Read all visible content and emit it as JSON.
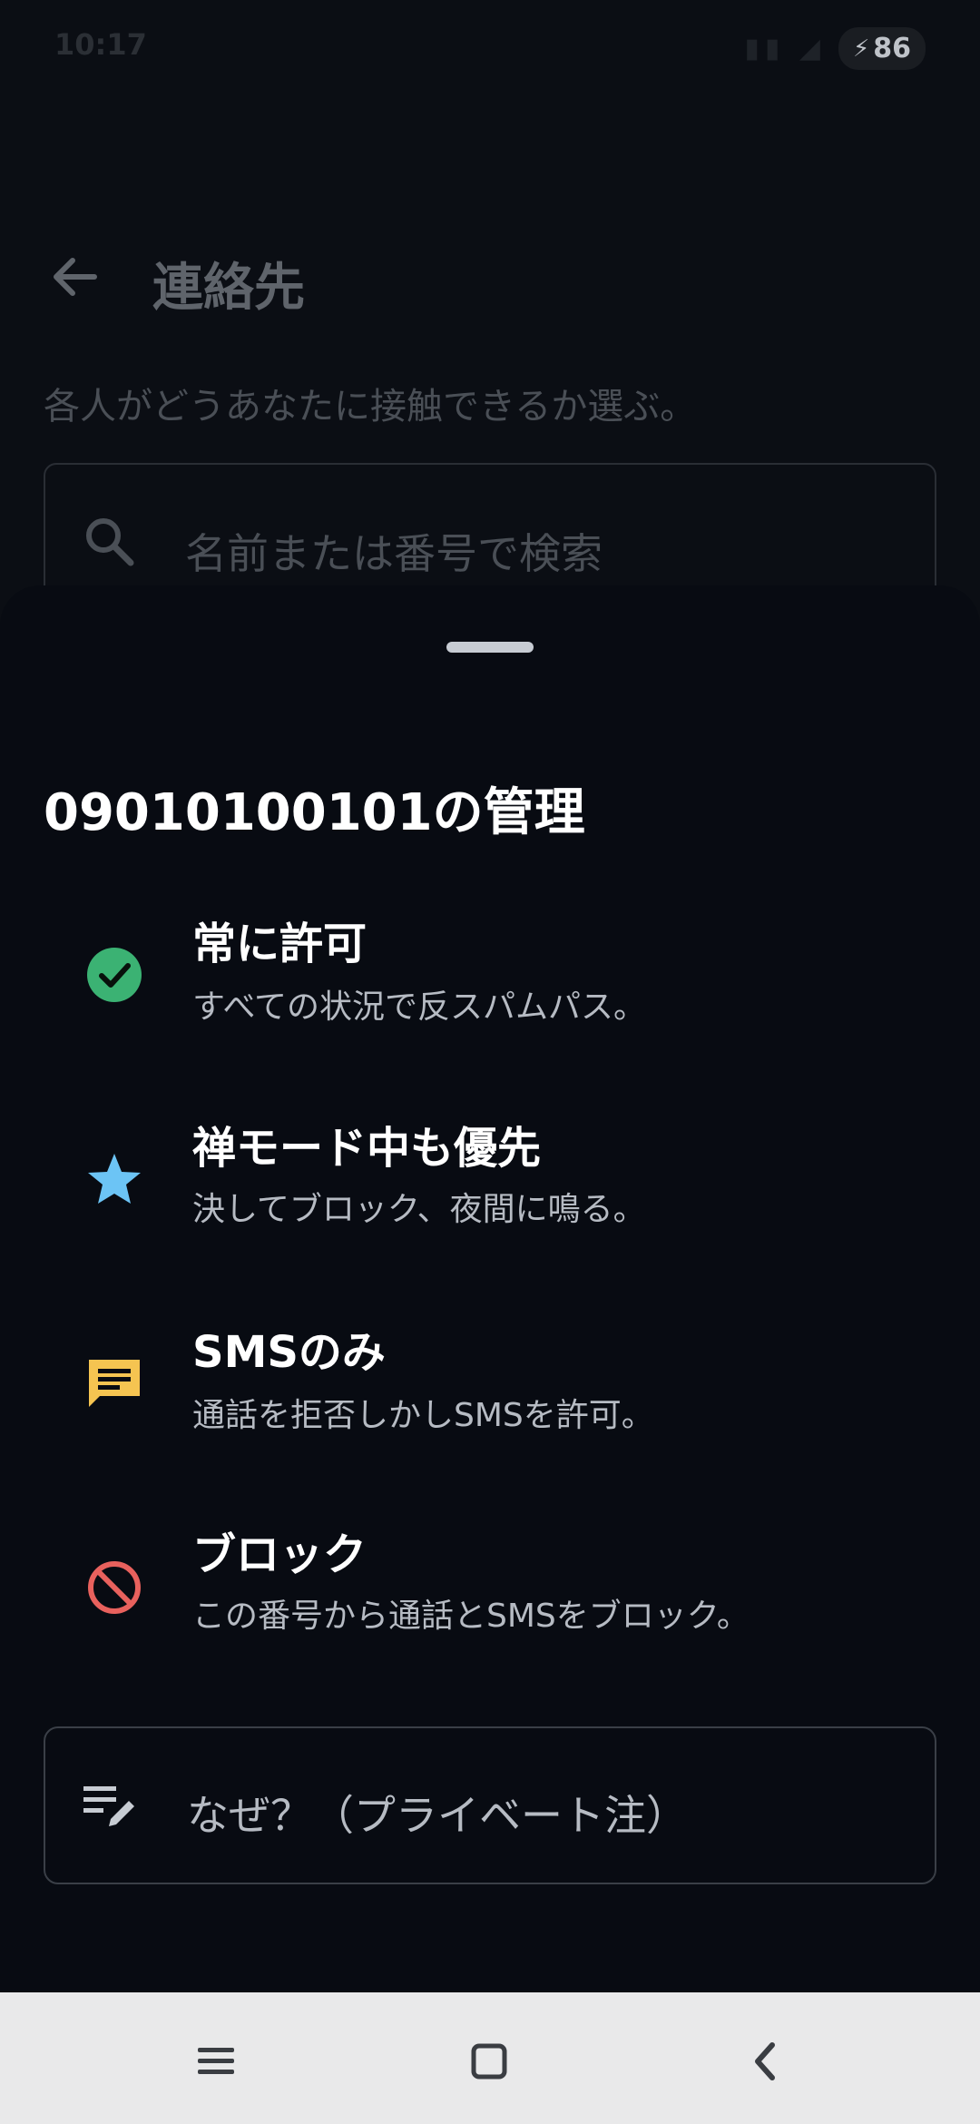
{
  "status_bar": {
    "time": "10:17",
    "battery_level": "86"
  },
  "app_bar": {
    "title": "連絡先"
  },
  "page": {
    "subtitle": "各人がどうあなたに接触できるか選ぶ。",
    "search": {
      "placeholder": "名前または番号で検索"
    }
  },
  "sheet": {
    "title": "09010100101の管理",
    "options": [
      {
        "title": "常に許可",
        "description": "すべての状況で反スパムパス。",
        "icon": "check-circle-icon",
        "color": "#3bb273"
      },
      {
        "title": "禅モード中も優先",
        "description": "決してブロック、夜間に鳴る。",
        "icon": "star-icon",
        "color": "#6cc4f5"
      },
      {
        "title": "SMSのみ",
        "description": "通話を拒否しかしSMSを許可。",
        "icon": "message-icon",
        "color": "#f5c451"
      },
      {
        "title": "ブロック",
        "description": "この番号から通話とSMSをブロック。",
        "icon": "block-icon",
        "color": "#e8615d"
      }
    ],
    "note": {
      "label": "なぜ？（プライベート注）",
      "icon": "edit-note-icon"
    }
  },
  "nav": {
    "menu_icon": "menu-icon",
    "home_icon": "home-square-icon",
    "back_icon": "back-chevron-icon"
  }
}
